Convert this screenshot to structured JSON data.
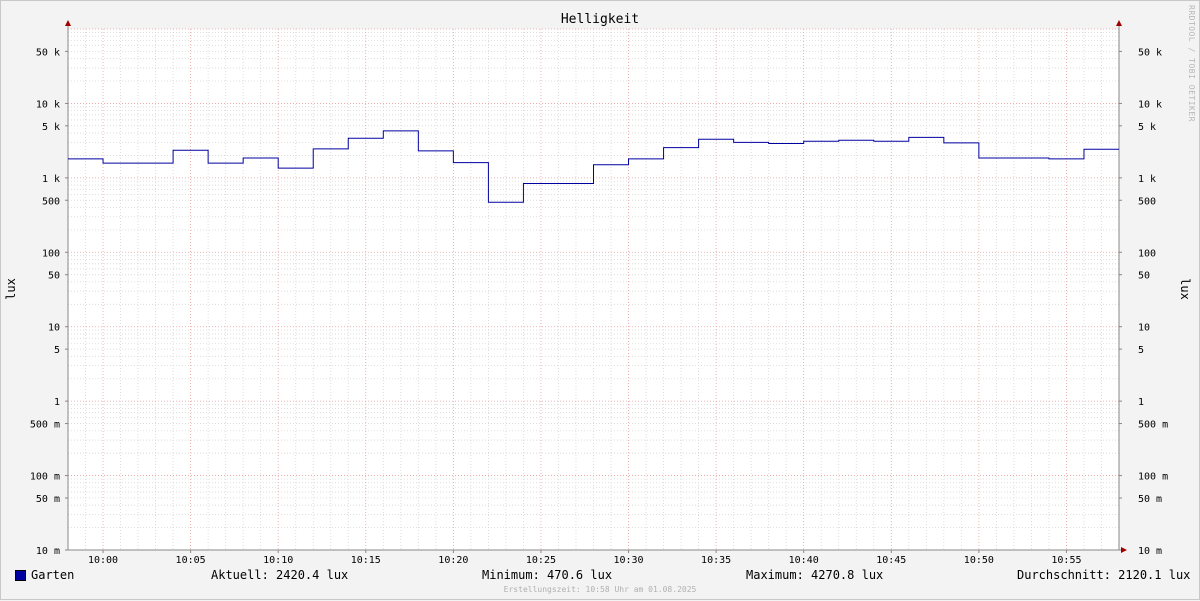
{
  "chart_data": {
    "type": "line",
    "title": "Helligkeit",
    "ylabel": "lux",
    "ylabel_right": "lux",
    "scale": "log",
    "ylim": [
      0.01,
      100000
    ],
    "xlim": [
      "09:58",
      "10:58"
    ],
    "x_ticks": [
      "10:00",
      "10:05",
      "10:10",
      "10:15",
      "10:20",
      "10:25",
      "10:30",
      "10:35",
      "10:40",
      "10:45",
      "10:50",
      "10:55"
    ],
    "y_ticks": [
      {
        "value": 50000,
        "label": "50 k"
      },
      {
        "value": 10000,
        "label": "10 k"
      },
      {
        "value": 5000,
        "label": "5 k"
      },
      {
        "value": 1000,
        "label": "1 k"
      },
      {
        "value": 500,
        "label": "500"
      },
      {
        "value": 100,
        "label": "100"
      },
      {
        "value": 50,
        "label": "50"
      },
      {
        "value": 10,
        "label": "10"
      },
      {
        "value": 5,
        "label": "5"
      },
      {
        "value": 1,
        "label": "1"
      },
      {
        "value": 0.5,
        "label": "500 m"
      },
      {
        "value": 0.1,
        "label": "100 m"
      },
      {
        "value": 0.05,
        "label": "50 m"
      },
      {
        "value": 0.01,
        "label": "10 m"
      }
    ],
    "grid": true,
    "series": [
      {
        "name": "Garten",
        "color": "#0000a0",
        "step": true,
        "points": [
          {
            "x": "09:58",
            "y": 1800
          },
          {
            "x": "10:00",
            "y": 1580
          },
          {
            "x": "10:04",
            "y": 2350
          },
          {
            "x": "10:06",
            "y": 1580
          },
          {
            "x": "10:08",
            "y": 1850
          },
          {
            "x": "10:10",
            "y": 1350
          },
          {
            "x": "10:12",
            "y": 2450
          },
          {
            "x": "10:14",
            "y": 3400
          },
          {
            "x": "10:16",
            "y": 4270.8
          },
          {
            "x": "10:18",
            "y": 2300
          },
          {
            "x": "10:20",
            "y": 1600
          },
          {
            "x": "10:22",
            "y": 470.6
          },
          {
            "x": "10:24",
            "y": 840
          },
          {
            "x": "10:28",
            "y": 1500
          },
          {
            "x": "10:30",
            "y": 1800
          },
          {
            "x": "10:32",
            "y": 2550
          },
          {
            "x": "10:34",
            "y": 3300
          },
          {
            "x": "10:36",
            "y": 3000
          },
          {
            "x": "10:38",
            "y": 2900
          },
          {
            "x": "10:40",
            "y": 3100
          },
          {
            "x": "10:42",
            "y": 3200
          },
          {
            "x": "10:44",
            "y": 3100
          },
          {
            "x": "10:46",
            "y": 3500
          },
          {
            "x": "10:48",
            "y": 2950
          },
          {
            "x": "10:50",
            "y": 1850
          },
          {
            "x": "10:54",
            "y": 1800
          },
          {
            "x": "10:56",
            "y": 2420.4
          },
          {
            "x": "10:58",
            "y": 2420.4
          }
        ]
      }
    ],
    "legend": {
      "series": "Garten",
      "aktuell": "Aktuell: 2420.4 lux",
      "minimum": "Minimum: 470.6 lux",
      "maximum": "Maximum: 4270.8 lux",
      "durchschnitt": "Durchschnitt: 2120.1 lux"
    },
    "footer": "Erstellungszeit: 10:58 Uhr am 01.08.2025",
    "watermark": "RRDTOOL / TOBI OETIKER",
    "colors": {
      "background": "#f3f3f3",
      "canvas": "#ffffff",
      "grid_minor": "#d6d6d6",
      "grid_major": "#e8a0a0",
      "line": "#0000a0",
      "arrow": "#a00000"
    }
  }
}
